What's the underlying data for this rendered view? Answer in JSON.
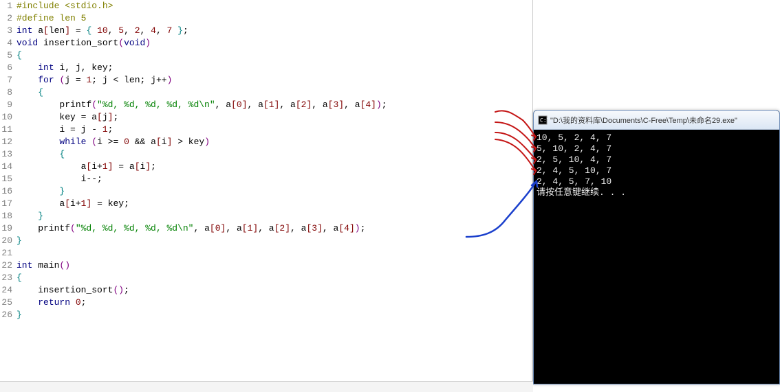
{
  "code": {
    "lines": [
      {
        "n": "1",
        "tokens": [
          [
            "tk-include",
            "#include <stdio.h>"
          ]
        ]
      },
      {
        "n": "2",
        "tokens": [
          [
            "tk-include",
            "#define len 5"
          ]
        ]
      },
      {
        "n": "3",
        "tokens": [
          [
            "tk-type",
            "int"
          ],
          [
            "tk-ident",
            " a"
          ],
          [
            "tk-bracket",
            "["
          ],
          [
            "tk-ident",
            "len"
          ],
          [
            "tk-bracket",
            "]"
          ],
          [
            "tk-op",
            " = "
          ],
          [
            "tk-brace",
            "{ "
          ],
          [
            "tk-num",
            "10"
          ],
          [
            "tk-punc",
            ", "
          ],
          [
            "tk-num",
            "5"
          ],
          [
            "tk-punc",
            ", "
          ],
          [
            "tk-num",
            "2"
          ],
          [
            "tk-punc",
            ", "
          ],
          [
            "tk-num",
            "4"
          ],
          [
            "tk-punc",
            ", "
          ],
          [
            "tk-num",
            "7"
          ],
          [
            "tk-brace",
            " }"
          ],
          [
            "tk-punc",
            ";"
          ]
        ]
      },
      {
        "n": "4",
        "tokens": [
          [
            "tk-type",
            "void"
          ],
          [
            "tk-ident",
            " insertion_sort"
          ],
          [
            "tk-paren",
            "("
          ],
          [
            "tk-type",
            "void"
          ],
          [
            "tk-paren",
            ")"
          ]
        ]
      },
      {
        "n": "5",
        "tokens": [
          [
            "tk-brace",
            "{"
          ]
        ]
      },
      {
        "n": "6",
        "tokens": [
          [
            "tk-ident",
            "    "
          ],
          [
            "tk-type",
            "int"
          ],
          [
            "tk-ident",
            " i"
          ],
          [
            "tk-punc",
            ", "
          ],
          [
            "tk-ident",
            "j"
          ],
          [
            "tk-punc",
            ", "
          ],
          [
            "tk-ident",
            "key"
          ],
          [
            "tk-punc",
            ";"
          ]
        ]
      },
      {
        "n": "7",
        "tokens": [
          [
            "tk-ident",
            "    "
          ],
          [
            "tk-keyword",
            "for"
          ],
          [
            "tk-ident",
            " "
          ],
          [
            "tk-paren",
            "("
          ],
          [
            "tk-ident",
            "j "
          ],
          [
            "tk-op",
            "="
          ],
          [
            "tk-ident",
            " "
          ],
          [
            "tk-num",
            "1"
          ],
          [
            "tk-punc",
            "; "
          ],
          [
            "tk-ident",
            "j "
          ],
          [
            "tk-op",
            "<"
          ],
          [
            "tk-ident",
            " len"
          ],
          [
            "tk-punc",
            "; "
          ],
          [
            "tk-ident",
            "j"
          ],
          [
            "tk-op",
            "++"
          ],
          [
            "tk-paren",
            ")"
          ]
        ]
      },
      {
        "n": "8",
        "tokens": [
          [
            "tk-ident",
            "    "
          ],
          [
            "tk-brace",
            "{"
          ]
        ]
      },
      {
        "n": "9",
        "tokens": [
          [
            "tk-ident",
            "        printf"
          ],
          [
            "tk-paren",
            "("
          ],
          [
            "tk-string",
            "\"%d, %d, %d, %d, %d\\n\""
          ],
          [
            "tk-punc",
            ", "
          ],
          [
            "tk-ident",
            "a"
          ],
          [
            "tk-bracket",
            "["
          ],
          [
            "tk-num",
            "0"
          ],
          [
            "tk-bracket",
            "]"
          ],
          [
            "tk-punc",
            ", "
          ],
          [
            "tk-ident",
            "a"
          ],
          [
            "tk-bracket",
            "["
          ],
          [
            "tk-num",
            "1"
          ],
          [
            "tk-bracket",
            "]"
          ],
          [
            "tk-punc",
            ", "
          ],
          [
            "tk-ident",
            "a"
          ],
          [
            "tk-bracket",
            "["
          ],
          [
            "tk-num",
            "2"
          ],
          [
            "tk-bracket",
            "]"
          ],
          [
            "tk-punc",
            ", "
          ],
          [
            "tk-ident",
            "a"
          ],
          [
            "tk-bracket",
            "["
          ],
          [
            "tk-num",
            "3"
          ],
          [
            "tk-bracket",
            "]"
          ],
          [
            "tk-punc",
            ", "
          ],
          [
            "tk-ident",
            "a"
          ],
          [
            "tk-bracket",
            "["
          ],
          [
            "tk-num",
            "4"
          ],
          [
            "tk-bracket",
            "]"
          ],
          [
            "tk-paren",
            ")"
          ],
          [
            "tk-punc",
            ";"
          ]
        ]
      },
      {
        "n": "10",
        "tokens": [
          [
            "tk-ident",
            "        key "
          ],
          [
            "tk-op",
            "="
          ],
          [
            "tk-ident",
            " a"
          ],
          [
            "tk-bracket",
            "["
          ],
          [
            "tk-ident",
            "j"
          ],
          [
            "tk-bracket",
            "]"
          ],
          [
            "tk-punc",
            ";"
          ]
        ]
      },
      {
        "n": "11",
        "tokens": [
          [
            "tk-ident",
            "        i "
          ],
          [
            "tk-op",
            "="
          ],
          [
            "tk-ident",
            " j "
          ],
          [
            "tk-op",
            "-"
          ],
          [
            "tk-ident",
            " "
          ],
          [
            "tk-num",
            "1"
          ],
          [
            "tk-punc",
            ";"
          ]
        ]
      },
      {
        "n": "12",
        "tokens": [
          [
            "tk-ident",
            "        "
          ],
          [
            "tk-keyword",
            "while"
          ],
          [
            "tk-ident",
            " "
          ],
          [
            "tk-paren",
            "("
          ],
          [
            "tk-ident",
            "i "
          ],
          [
            "tk-op",
            ">="
          ],
          [
            "tk-ident",
            " "
          ],
          [
            "tk-num",
            "0"
          ],
          [
            "tk-ident",
            " "
          ],
          [
            "tk-op",
            "&&"
          ],
          [
            "tk-ident",
            " a"
          ],
          [
            "tk-bracket",
            "["
          ],
          [
            "tk-ident",
            "i"
          ],
          [
            "tk-bracket",
            "]"
          ],
          [
            "tk-ident",
            " "
          ],
          [
            "tk-op",
            ">"
          ],
          [
            "tk-ident",
            " key"
          ],
          [
            "tk-paren",
            ")"
          ]
        ]
      },
      {
        "n": "13",
        "tokens": [
          [
            "tk-ident",
            "        "
          ],
          [
            "tk-brace",
            "{"
          ]
        ]
      },
      {
        "n": "14",
        "tokens": [
          [
            "tk-ident",
            "            a"
          ],
          [
            "tk-bracket",
            "["
          ],
          [
            "tk-ident",
            "i"
          ],
          [
            "tk-op",
            "+"
          ],
          [
            "tk-num",
            "1"
          ],
          [
            "tk-bracket",
            "]"
          ],
          [
            "tk-ident",
            " "
          ],
          [
            "tk-op",
            "="
          ],
          [
            "tk-ident",
            " a"
          ],
          [
            "tk-bracket",
            "["
          ],
          [
            "tk-ident",
            "i"
          ],
          [
            "tk-bracket",
            "]"
          ],
          [
            "tk-punc",
            ";"
          ]
        ]
      },
      {
        "n": "15",
        "tokens": [
          [
            "tk-ident",
            "            i"
          ],
          [
            "tk-op",
            "--"
          ],
          [
            "tk-punc",
            ";"
          ]
        ]
      },
      {
        "n": "16",
        "tokens": [
          [
            "tk-ident",
            "        "
          ],
          [
            "tk-brace",
            "}"
          ]
        ]
      },
      {
        "n": "17",
        "tokens": [
          [
            "tk-ident",
            "        a"
          ],
          [
            "tk-bracket",
            "["
          ],
          [
            "tk-ident",
            "i"
          ],
          [
            "tk-op",
            "+"
          ],
          [
            "tk-num",
            "1"
          ],
          [
            "tk-bracket",
            "]"
          ],
          [
            "tk-ident",
            " "
          ],
          [
            "tk-op",
            "="
          ],
          [
            "tk-ident",
            " key"
          ],
          [
            "tk-punc",
            ";"
          ]
        ]
      },
      {
        "n": "18",
        "tokens": [
          [
            "tk-ident",
            "    "
          ],
          [
            "tk-brace",
            "}"
          ]
        ]
      },
      {
        "n": "19",
        "tokens": [
          [
            "tk-ident",
            "    printf"
          ],
          [
            "tk-paren",
            "("
          ],
          [
            "tk-string",
            "\"%d, %d, %d, %d, %d\\n\""
          ],
          [
            "tk-punc",
            ", "
          ],
          [
            "tk-ident",
            "a"
          ],
          [
            "tk-bracket",
            "["
          ],
          [
            "tk-num",
            "0"
          ],
          [
            "tk-bracket",
            "]"
          ],
          [
            "tk-punc",
            ", "
          ],
          [
            "tk-ident",
            "a"
          ],
          [
            "tk-bracket",
            "["
          ],
          [
            "tk-num",
            "1"
          ],
          [
            "tk-bracket",
            "]"
          ],
          [
            "tk-punc",
            ", "
          ],
          [
            "tk-ident",
            "a"
          ],
          [
            "tk-bracket",
            "["
          ],
          [
            "tk-num",
            "2"
          ],
          [
            "tk-bracket",
            "]"
          ],
          [
            "tk-punc",
            ", "
          ],
          [
            "tk-ident",
            "a"
          ],
          [
            "tk-bracket",
            "["
          ],
          [
            "tk-num",
            "3"
          ],
          [
            "tk-bracket",
            "]"
          ],
          [
            "tk-punc",
            ", "
          ],
          [
            "tk-ident",
            "a"
          ],
          [
            "tk-bracket",
            "["
          ],
          [
            "tk-num",
            "4"
          ],
          [
            "tk-bracket",
            "]"
          ],
          [
            "tk-paren",
            ")"
          ],
          [
            "tk-punc",
            ";"
          ]
        ]
      },
      {
        "n": "20",
        "tokens": [
          [
            "tk-brace",
            "}"
          ]
        ]
      },
      {
        "n": "21",
        "tokens": [
          [
            "",
            ""
          ]
        ]
      },
      {
        "n": "22",
        "tokens": [
          [
            "tk-type",
            "int"
          ],
          [
            "tk-ident",
            " main"
          ],
          [
            "tk-paren",
            "()"
          ]
        ]
      },
      {
        "n": "23",
        "tokens": [
          [
            "tk-brace",
            "{"
          ]
        ]
      },
      {
        "n": "24",
        "tokens": [
          [
            "tk-ident",
            "    insertion_sort"
          ],
          [
            "tk-paren",
            "()"
          ],
          [
            "tk-punc",
            ";"
          ]
        ]
      },
      {
        "n": "25",
        "tokens": [
          [
            "tk-ident",
            "    "
          ],
          [
            "tk-keyword",
            "return"
          ],
          [
            "tk-ident",
            " "
          ],
          [
            "tk-num",
            "0"
          ],
          [
            "tk-punc",
            ";"
          ]
        ]
      },
      {
        "n": "26",
        "tokens": [
          [
            "tk-brace",
            "}"
          ]
        ]
      }
    ]
  },
  "console": {
    "title": "\"D:\\我的资料库\\Documents\\C-Free\\Temp\\未命名29.exe\"",
    "lines": [
      "10, 5, 2, 4, 7",
      "5, 10, 2, 4, 7",
      "2, 5, 10, 4, 7",
      "2, 4, 5, 10, 7",
      "2, 4, 5, 7, 10",
      "请按任意键继续. . ."
    ]
  },
  "annotations": {
    "red_stroke": "#c41515",
    "blue_stroke": "#1a3fcc"
  }
}
